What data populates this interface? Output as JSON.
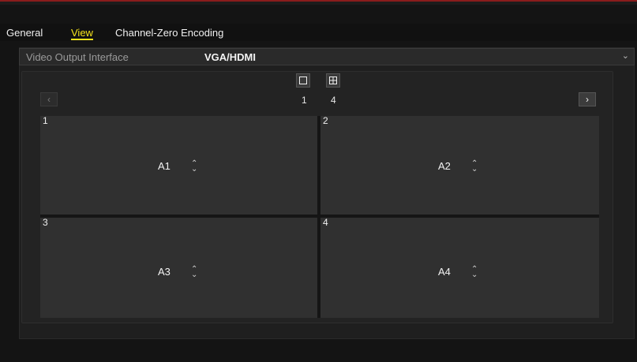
{
  "tabs": [
    "General",
    "View",
    "Channel-Zero Encoding"
  ],
  "video_output": {
    "label": "Video Output Interface",
    "value": "VGA/HDMI"
  },
  "layouts": [
    {
      "label": "1",
      "icon": "single-window-icon"
    },
    {
      "label": "4",
      "icon": "quad-window-icon"
    }
  ],
  "nav": {
    "prev_icon": "chevron-left-icon",
    "next_icon": "chevron-right-icon"
  },
  "windows": [
    {
      "number": "1",
      "channel": "A1"
    },
    {
      "number": "2",
      "channel": "A2"
    },
    {
      "number": "3",
      "channel": "A3"
    },
    {
      "number": "4",
      "channel": "A4"
    }
  ],
  "colors": {
    "active_tab": "#f5e21c",
    "background": "#141414",
    "tile": "#303030"
  }
}
